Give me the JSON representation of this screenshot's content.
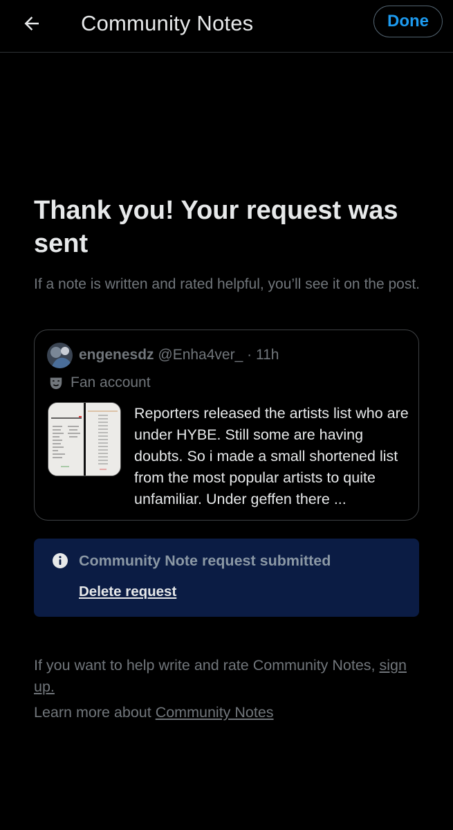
{
  "header": {
    "title": "Community Notes",
    "done_label": "Done"
  },
  "confirmation": {
    "title": "Thank you! Your request was sent",
    "subtitle": "If a note is written and rated helpful, you’ll see it on the post."
  },
  "post": {
    "author_name": "engenesdz",
    "author_handle": "@Enha4ver_",
    "separator": "·",
    "time": "11h",
    "label": "Fan account",
    "text": "Reporters released the artists list who are under HYBE. Still some are having doubts. So i made a small shortened list from the most popular artists to quite unfamiliar.  Under geffen there ..."
  },
  "notice": {
    "text": "Community Note request submitted",
    "delete_label": "Delete request"
  },
  "footer": {
    "help_text": "If you want to help write and rate Community Notes, ",
    "signup_link": "sign up.",
    "learn_text": "Learn more about ",
    "learn_link": "Community Notes"
  },
  "icons": {
    "back": "back-arrow-icon",
    "info": "info-icon",
    "fan": "mask-icon"
  },
  "colors": {
    "background": "#000000",
    "accent": "#1d9bf0",
    "notice_bg": "#0b1c44",
    "muted_text": "#71767b"
  }
}
